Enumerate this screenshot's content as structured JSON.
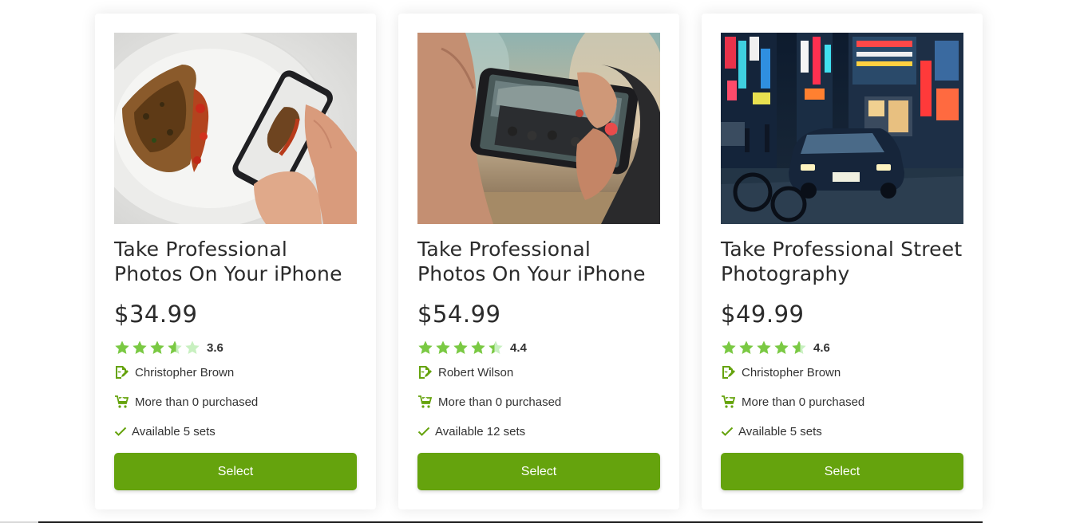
{
  "colors": {
    "accent": "#65a30d",
    "star_full": "#7ac943",
    "star_empty": "#c8f0c0"
  },
  "cards": [
    {
      "image": "phone-photographing-food-dish",
      "title": "Take Professional Photos On Your iPhone",
      "price": "$34.99",
      "rating": 3.6,
      "rating_label": "3.6",
      "author": "Christopher Brown",
      "purchased": "More than 0 purchased",
      "available": "Available 5 sets",
      "button": "Select"
    },
    {
      "image": "phone-photographing-interior-hall",
      "title": "Take Professional Photos On Your iPhone",
      "price": "$54.99",
      "rating": 4.4,
      "rating_label": "4.4",
      "author": "Robert Wilson",
      "purchased": "More than 0 purchased",
      "available": "Available 12 sets",
      "button": "Select"
    },
    {
      "image": "night-street-with-taxi-and-neon-signs",
      "title": "Take Professional Street Photography",
      "price": "$49.99",
      "rating": 4.6,
      "rating_label": "4.6",
      "author": "Christopher Brown",
      "purchased": "More than 0 purchased",
      "available": "Available 5 sets",
      "button": "Select"
    }
  ]
}
